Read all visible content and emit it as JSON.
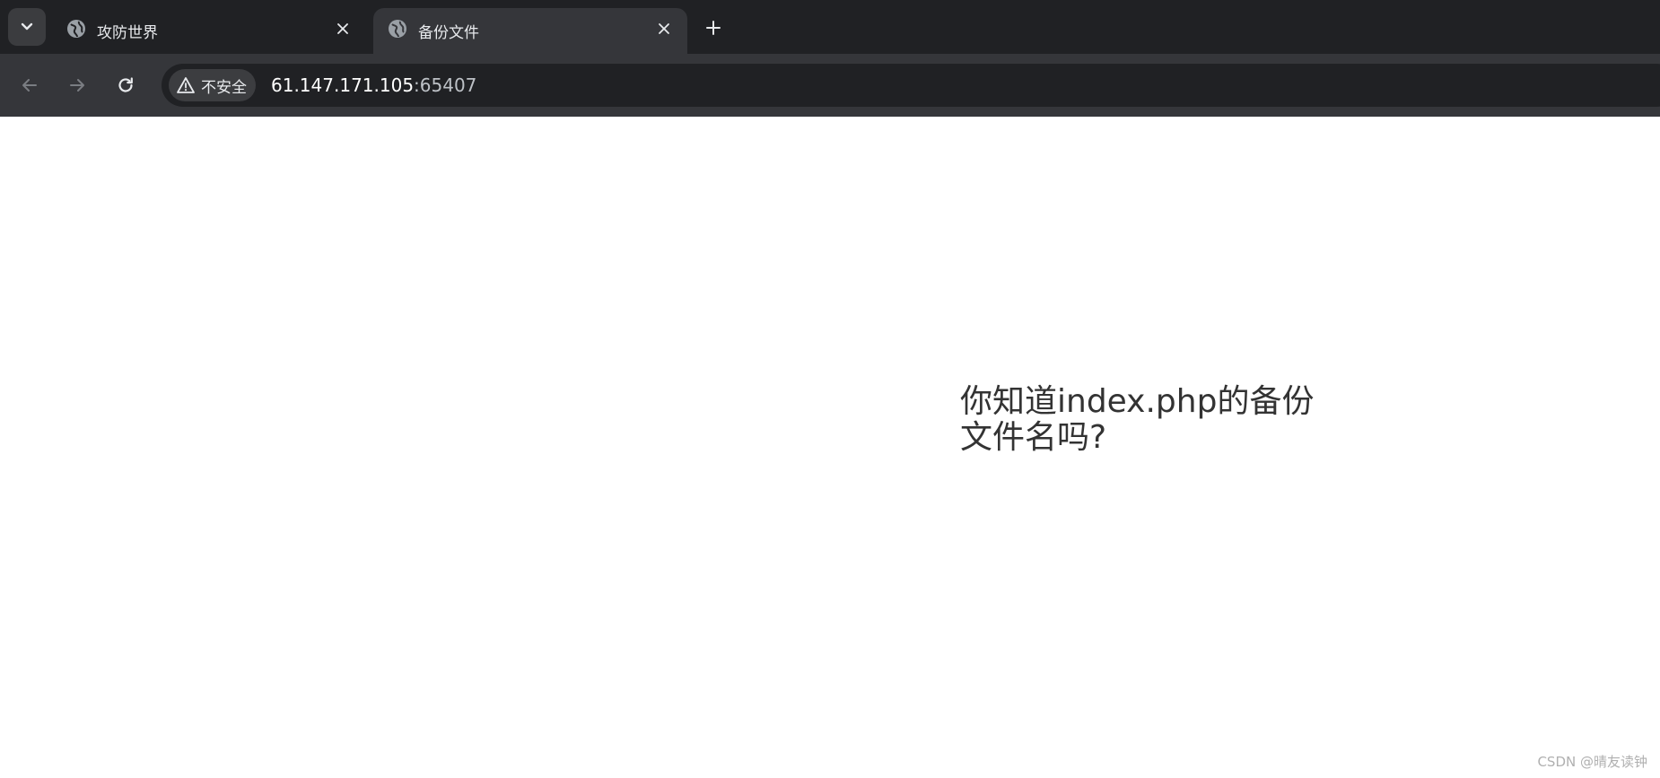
{
  "browser": {
    "tabs": [
      {
        "title": "攻防世界",
        "active": false
      },
      {
        "title": "备份文件",
        "active": true
      }
    ],
    "security_label": "不安全",
    "url": {
      "host": "61.147.171.105",
      "port": ":65407"
    }
  },
  "page": {
    "question": "你知道index.php的备份文件名吗?"
  },
  "watermark": "CSDN @晴友读钟",
  "colors": {
    "tabstrip_bg": "#202124",
    "toolbar_bg": "#35363a",
    "omnibox_bg": "#202124",
    "text_dark": "#333333"
  }
}
